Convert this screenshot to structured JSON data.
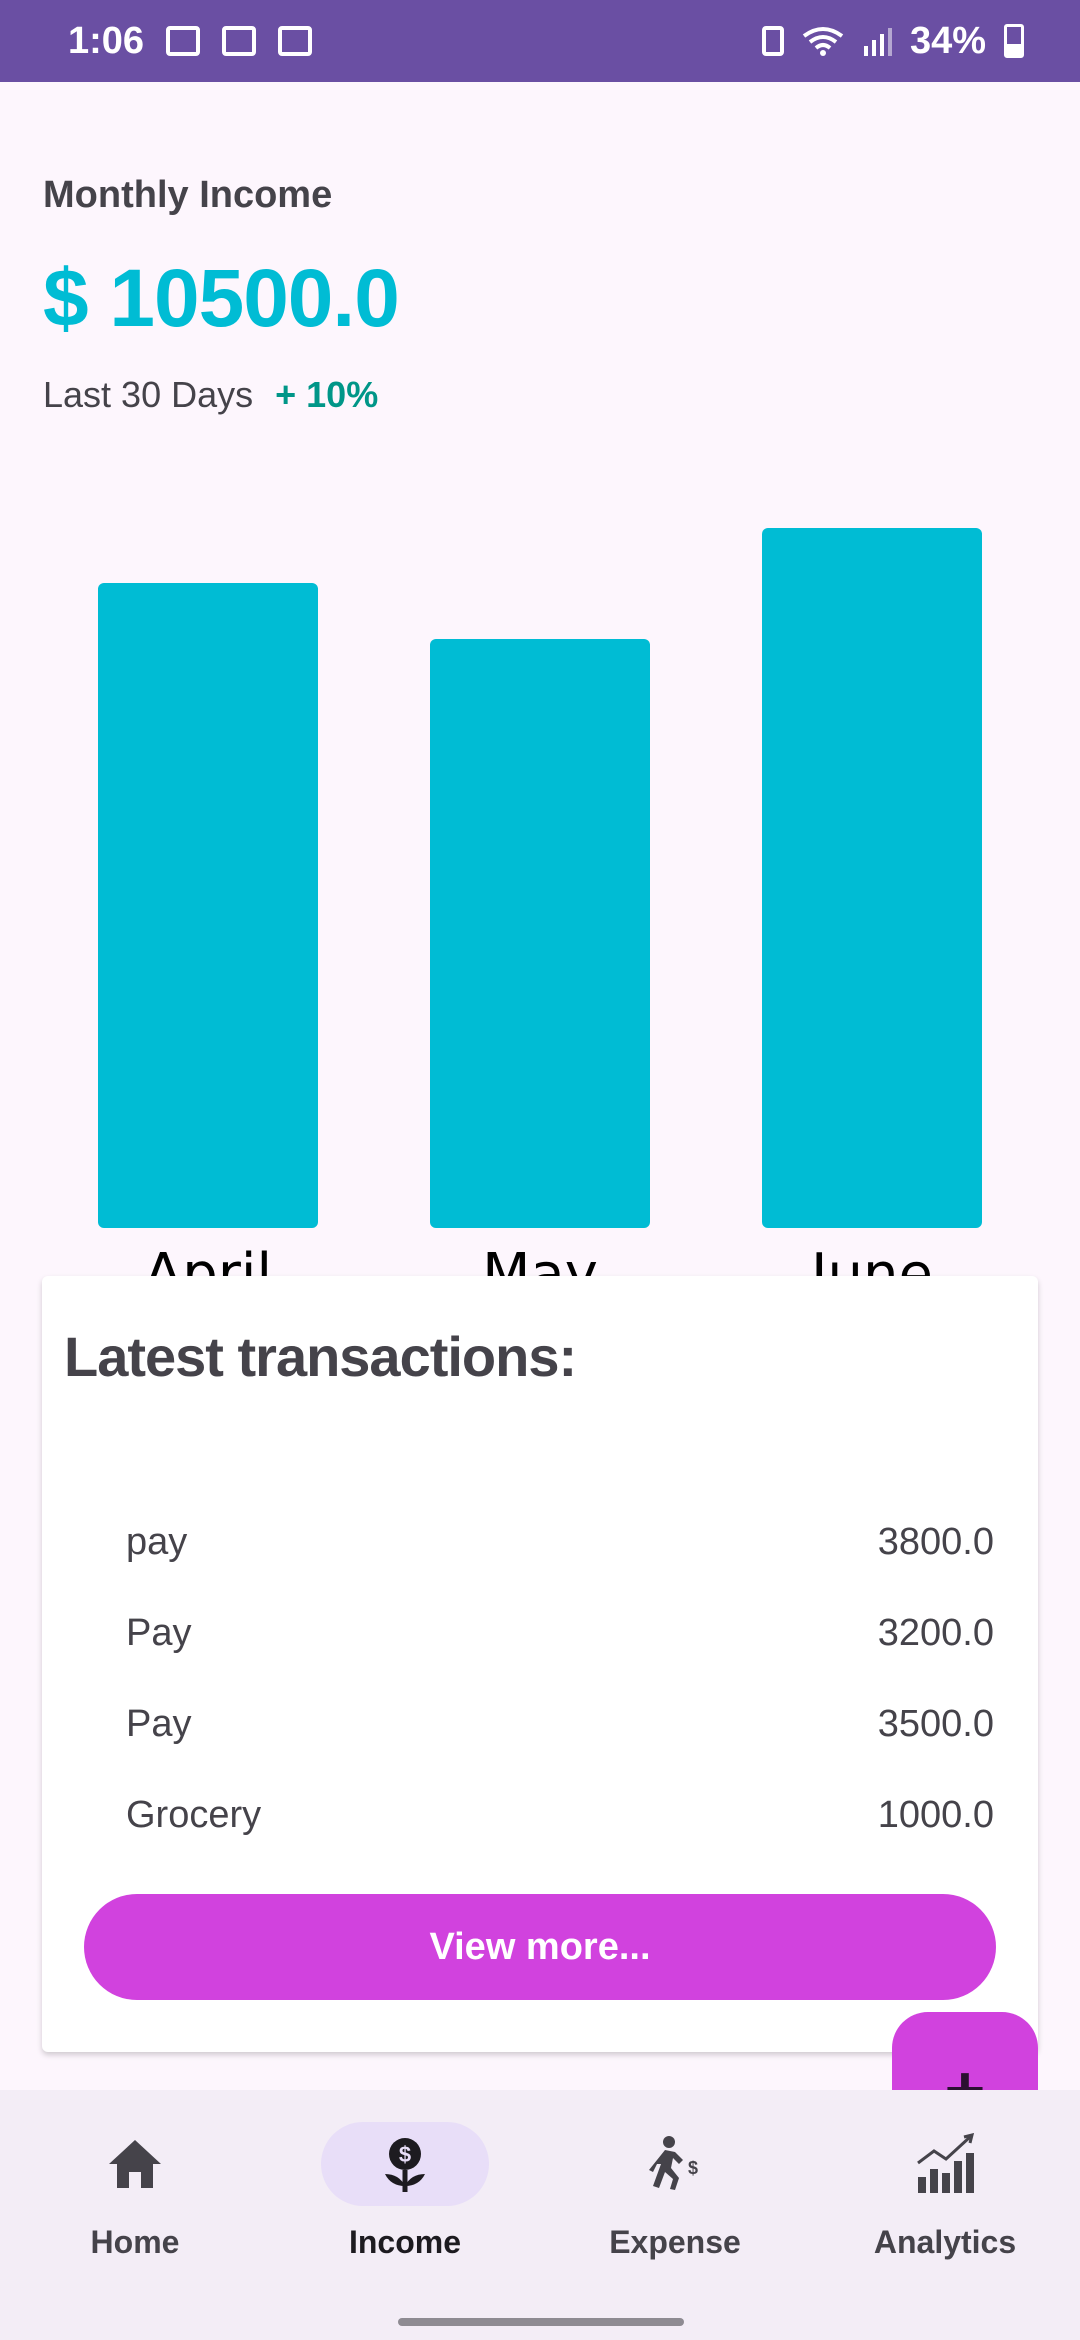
{
  "status_bar": {
    "time": "1:06",
    "battery": "34%"
  },
  "income": {
    "title": "Monthly Income",
    "amount": "$ 10500.0",
    "period_label": "Last 30 Days",
    "period_change": "+ 10%"
  },
  "chart_data": {
    "type": "bar",
    "categories": [
      "April",
      "May",
      "June"
    ],
    "values": [
      3500,
      3200,
      3800
    ],
    "ylim": [
      0,
      3800
    ],
    "grid": false,
    "color": "#00bcd4"
  },
  "transactions": {
    "title": "Latest transactions:",
    "items": [
      {
        "name": "pay",
        "amount": "3800.0"
      },
      {
        "name": "Pay",
        "amount": "3200.0"
      },
      {
        "name": "Pay",
        "amount": "3500.0"
      },
      {
        "name": "Grocery",
        "amount": "1000.0"
      }
    ],
    "view_more_label": "View more..."
  },
  "fab": {
    "label": "+"
  },
  "bottom_nav": {
    "items": [
      {
        "label": "Home",
        "icon": "home-icon"
      },
      {
        "label": "Income",
        "icon": "income-icon"
      },
      {
        "label": "Expense",
        "icon": "expense-icon"
      },
      {
        "label": "Analytics",
        "icon": "analytics-icon"
      }
    ],
    "active": "Income"
  },
  "colors": {
    "accent": "#00bcd4",
    "positive": "#009688",
    "button": "#d142de",
    "status_bar": "#6a4fa3"
  }
}
